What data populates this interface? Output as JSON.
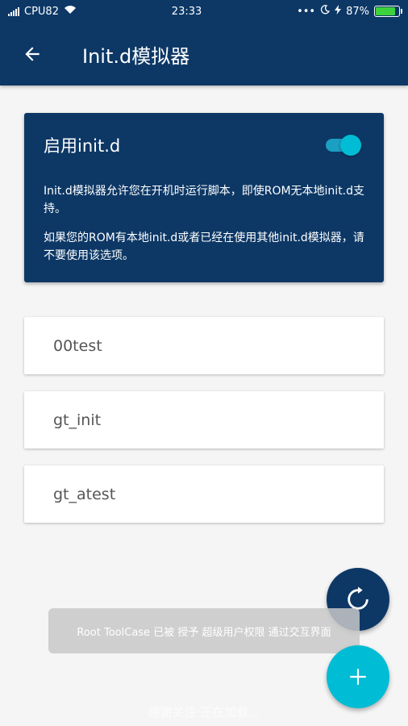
{
  "status_bar": {
    "carrier": "CPU82",
    "time": "23:33",
    "dots": "•••",
    "battery_text": "87%",
    "battery_level": 0.87
  },
  "app_bar": {
    "title": "Init.d模拟器"
  },
  "card": {
    "toggle_label": "启用init.d",
    "toggle_on": true,
    "description_1": "Init.d模拟器允许您在开机时运行脚本，即使ROM无本地init.d支持。",
    "description_2": "如果您的ROM有本地init.d或者已经在使用其他init.d模拟器，请不要使用该选项。"
  },
  "scripts": [
    "00test",
    "gt_init",
    "gt_atest"
  ],
  "toast": {
    "text": "Root ToolCase 已被 授予 超级用户权限 通过交互界面"
  },
  "bottom_hint": "感谢关注·正在加载..."
}
